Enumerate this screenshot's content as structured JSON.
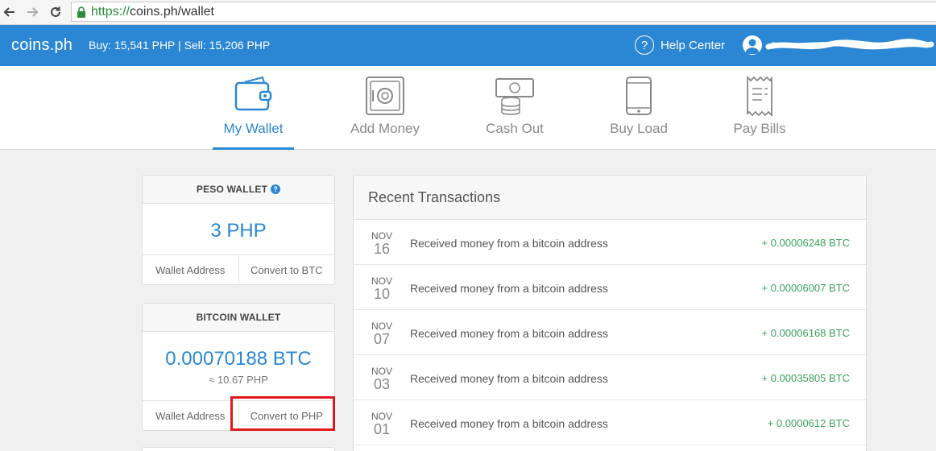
{
  "browser": {
    "url_scheme": "https://",
    "url_rest": "coins.ph/wallet"
  },
  "header": {
    "logo": "coins.ph",
    "rates": "Buy: 15,541 PHP | Sell: 15,206 PHP",
    "help_label": "Help Center",
    "help_glyph": "?"
  },
  "nav": {
    "items": [
      {
        "label": "My Wallet",
        "icon": "wallet-icon"
      },
      {
        "label": "Add Money",
        "icon": "safe-icon"
      },
      {
        "label": "Cash Out",
        "icon": "cash-icon"
      },
      {
        "label": "Buy Load",
        "icon": "phone-icon"
      },
      {
        "label": "Pay Bills",
        "icon": "receipt-icon"
      }
    ],
    "active": "My Wallet"
  },
  "peso_wallet": {
    "title": "PESO WALLET",
    "info_glyph": "?",
    "balance": "3 PHP",
    "wallet_address_label": "Wallet Address",
    "convert_label": "Convert to BTC"
  },
  "bitcoin_wallet": {
    "title": "BITCOIN WALLET",
    "balance": "0.00070188 BTC",
    "php_equiv": "≈ 10.67 PHP",
    "wallet_address_label": "Wallet Address",
    "convert_label": "Convert to PHP"
  },
  "transactions": {
    "title": "Recent Transactions",
    "rows": [
      {
        "month": "NOV",
        "day": "16",
        "desc": "Received money from a bitcoin address",
        "amount": "+ 0.00006248 BTC"
      },
      {
        "month": "NOV",
        "day": "10",
        "desc": "Received money from a bitcoin address",
        "amount": "+ 0.00006007 BTC"
      },
      {
        "month": "NOV",
        "day": "07",
        "desc": "Received money from a bitcoin address",
        "amount": "+ 0.00006168 BTC"
      },
      {
        "month": "NOV",
        "day": "03",
        "desc": "Received money from a bitcoin address",
        "amount": "+ 0.00035805 BTC"
      },
      {
        "month": "NOV",
        "day": "01",
        "desc": "Received money from a bitcoin address",
        "amount": "+ 0.0000612 BTC"
      }
    ]
  },
  "colors": {
    "brand": "#2b87d3",
    "positive": "#3aa15c",
    "highlight": "#e0181c"
  }
}
